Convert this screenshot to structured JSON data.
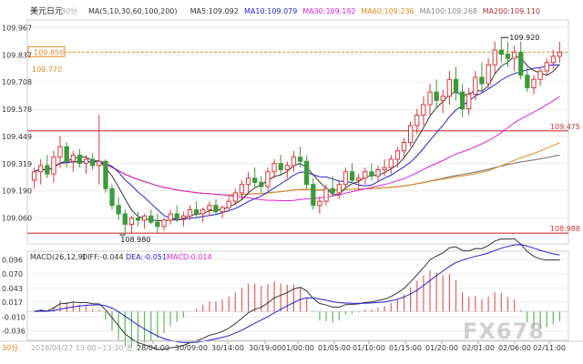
{
  "chart_data": {
    "type": "candlestick",
    "symbol": "美元日元",
    "timeframe": "30分",
    "ma_header": "MA(5,10,30,60,100,200)",
    "ma": [
      {
        "label": "MA5",
        "value": "109.092",
        "color": "#333333"
      },
      {
        "label": "MA10",
        "value": "109.079",
        "color": "#2222cc"
      },
      {
        "label": "MA30",
        "value": "109.192",
        "color": "#dd22dd"
      },
      {
        "label": "MA60",
        "value": "109.236",
        "color": "#e08a1e"
      },
      {
        "label": "MA100",
        "value": "109.268",
        "color": "#888888"
      },
      {
        "label": "MA200",
        "value": "109.110",
        "color": "#a83232"
      }
    ],
    "price_axis": {
      "ticks": [
        "109.967",
        "109.837",
        "109.708",
        "109.578",
        "109.449",
        "109.319",
        "109.190",
        "109.060"
      ],
      "range": [
        108.95,
        109.99
      ]
    },
    "current_price": "109.850",
    "left_label": "109.770",
    "levels": [
      {
        "value": 109.475,
        "label": "109.475",
        "color": "#cc3333"
      },
      {
        "value": 108.988,
        "label": "108.988",
        "color": "#cc3333"
      }
    ],
    "annotations": {
      "high": "109.920",
      "low": "108.980"
    },
    "macd": {
      "header": "MACD(26,12,9)",
      "diff": "DIFF:-0.044",
      "dea": "DEA:-0.051",
      "macd": "MACD:0.014",
      "ticks": [
        "0.096",
        "0.070",
        "0.043",
        "0.017",
        "-0.010",
        "-0.036"
      ],
      "range": [
        -0.05,
        0.1
      ]
    },
    "x_axis": {
      "labels": [
        "2018/04/27 13:00~13:30 五",
        "28/04:00",
        "30/09:00",
        "30/14:00",
        "30/19:00",
        "01/00:00",
        "01/05:00",
        "01/10:00",
        "01/15:00",
        "01/20:00",
        "02/01:00",
        "02/06:00",
        "02/11:00"
      ],
      "bottom_left": "30分"
    },
    "candles": [
      [
        109.24,
        109.3,
        109.2,
        109.28
      ],
      [
        109.28,
        109.34,
        109.22,
        109.31
      ],
      [
        109.31,
        109.36,
        109.25,
        109.27
      ],
      [
        109.27,
        109.38,
        109.23,
        109.35
      ],
      [
        109.35,
        109.45,
        109.3,
        109.4
      ],
      [
        109.4,
        109.42,
        109.3,
        109.33
      ],
      [
        109.33,
        109.38,
        109.28,
        109.36
      ],
      [
        109.36,
        109.39,
        109.3,
        109.32
      ],
      [
        109.32,
        109.36,
        109.27,
        109.34
      ],
      [
        109.34,
        109.37,
        109.29,
        109.31
      ],
      [
        109.31,
        109.55,
        109.22,
        109.33
      ],
      [
        109.33,
        109.34,
        109.18,
        109.2
      ],
      [
        109.2,
        109.22,
        109.1,
        109.12
      ],
      [
        109.12,
        109.16,
        109.05,
        109.08
      ],
      [
        109.08,
        109.1,
        108.98,
        109.03
      ],
      [
        109.03,
        109.07,
        108.99,
        109.06
      ],
      [
        109.06,
        109.09,
        109.02,
        109.05
      ],
      [
        109.05,
        109.08,
        109.01,
        109.07
      ],
      [
        109.07,
        109.1,
        109.03,
        109.04
      ],
      [
        109.04,
        109.08,
        108.99,
        109.02
      ],
      [
        109.02,
        109.06,
        109.0,
        109.05
      ],
      [
        109.05,
        109.1,
        109.03,
        109.08
      ],
      [
        109.08,
        109.12,
        109.04,
        109.06
      ],
      [
        109.06,
        109.09,
        109.02,
        109.07
      ],
      [
        109.07,
        109.12,
        109.05,
        109.1
      ],
      [
        109.1,
        109.14,
        109.06,
        109.08
      ],
      [
        109.08,
        109.11,
        109.04,
        109.1
      ],
      [
        109.1,
        109.14,
        109.07,
        109.12
      ],
      [
        109.12,
        109.15,
        109.08,
        109.09
      ],
      [
        109.09,
        109.12,
        109.06,
        109.11
      ],
      [
        109.11,
        109.16,
        109.09,
        109.14
      ],
      [
        109.14,
        109.2,
        109.12,
        109.18
      ],
      [
        109.18,
        109.24,
        109.15,
        109.22
      ],
      [
        109.22,
        109.28,
        109.18,
        109.25
      ],
      [
        109.25,
        109.3,
        109.2,
        109.23
      ],
      [
        109.23,
        109.26,
        109.18,
        109.21
      ],
      [
        109.21,
        109.3,
        109.19,
        109.28
      ],
      [
        109.28,
        109.34,
        109.25,
        109.32
      ],
      [
        109.32,
        109.36,
        109.26,
        109.29
      ],
      [
        109.29,
        109.33,
        109.25,
        109.31
      ],
      [
        109.31,
        109.38,
        109.28,
        109.35
      ],
      [
        109.35,
        109.4,
        109.3,
        109.33
      ],
      [
        109.33,
        109.36,
        109.2,
        109.22
      ],
      [
        109.22,
        109.25,
        109.1,
        109.12
      ],
      [
        109.12,
        109.16,
        109.08,
        109.14
      ],
      [
        109.14,
        109.22,
        109.12,
        109.2
      ],
      [
        109.2,
        109.26,
        109.16,
        109.18
      ],
      [
        109.18,
        109.24,
        109.15,
        109.22
      ],
      [
        109.22,
        109.3,
        109.2,
        109.28
      ],
      [
        109.28,
        109.32,
        109.22,
        109.24
      ],
      [
        109.24,
        109.27,
        109.2,
        109.25
      ],
      [
        109.25,
        109.3,
        109.22,
        109.28
      ],
      [
        109.28,
        109.32,
        109.24,
        109.26
      ],
      [
        109.26,
        109.31,
        109.23,
        109.29
      ],
      [
        109.29,
        109.34,
        109.26,
        109.3
      ],
      [
        109.3,
        109.36,
        109.27,
        109.34
      ],
      [
        109.34,
        109.4,
        109.3,
        109.38
      ],
      [
        109.38,
        109.44,
        109.34,
        109.42
      ],
      [
        109.42,
        109.52,
        109.4,
        109.5
      ],
      [
        109.5,
        109.58,
        109.46,
        109.55
      ],
      [
        109.55,
        109.64,
        109.5,
        109.6
      ],
      [
        109.6,
        109.7,
        109.55,
        109.66
      ],
      [
        109.66,
        109.72,
        109.58,
        109.62
      ],
      [
        109.62,
        109.67,
        109.56,
        109.64
      ],
      [
        109.64,
        109.76,
        109.6,
        109.72
      ],
      [
        109.72,
        109.78,
        109.62,
        109.66
      ],
      [
        109.66,
        109.7,
        109.54,
        109.58
      ],
      [
        109.58,
        109.68,
        109.55,
        109.65
      ],
      [
        109.65,
        109.76,
        109.62,
        109.73
      ],
      [
        109.73,
        109.8,
        109.66,
        109.7
      ],
      [
        109.7,
        109.82,
        109.68,
        109.79
      ],
      [
        109.79,
        109.9,
        109.75,
        109.86
      ],
      [
        109.86,
        109.92,
        109.8,
        109.84
      ],
      [
        109.84,
        109.9,
        109.78,
        109.82
      ],
      [
        109.82,
        109.88,
        109.76,
        109.85
      ],
      [
        109.85,
        109.9,
        109.72,
        109.74
      ],
      [
        109.74,
        109.78,
        109.66,
        109.68
      ],
      [
        109.68,
        109.74,
        109.65,
        109.72
      ],
      [
        109.72,
        109.78,
        109.69,
        109.76
      ],
      [
        109.76,
        109.82,
        109.74,
        109.8
      ],
      [
        109.8,
        109.86,
        109.77,
        109.83
      ],
      [
        109.83,
        109.9,
        109.8,
        109.85
      ]
    ]
  }
}
